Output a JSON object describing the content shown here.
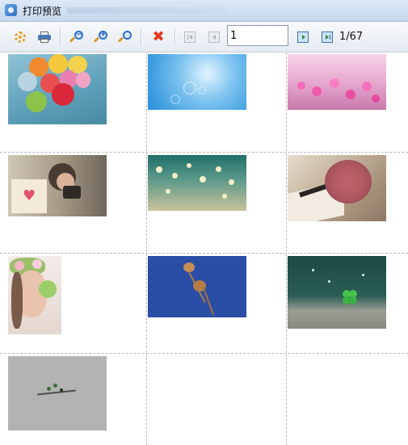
{
  "window": {
    "title": "打印预览"
  },
  "toolbar": {
    "buttons": [
      {
        "name": "settings",
        "icon": "gear-icon"
      },
      {
        "name": "print",
        "icon": "printer-icon"
      },
      {
        "name": "zoom-out",
        "icon": "zoom-out-icon"
      },
      {
        "name": "zoom-in",
        "icon": "zoom-in-icon"
      },
      {
        "name": "zoom",
        "icon": "zoom-icon"
      },
      {
        "name": "close",
        "icon": "close-icon"
      },
      {
        "name": "first-page",
        "icon": "first-page-icon"
      },
      {
        "name": "previous-page",
        "icon": "previous-page-icon"
      },
      {
        "name": "next-page",
        "icon": "next-page-icon"
      },
      {
        "name": "last-page",
        "icon": "last-page-icon"
      }
    ],
    "page_input_value": "1",
    "page_count": "1/67"
  },
  "grid": {
    "columns": 3,
    "images": [
      {
        "subject": "balloons"
      },
      {
        "subject": "blue sky bokeh"
      },
      {
        "subject": "pink flowers"
      },
      {
        "subject": "girl with camera and heart card"
      },
      {
        "subject": "bokeh lights"
      },
      {
        "subject": "rose on book"
      },
      {
        "subject": "girl with flower crown"
      },
      {
        "subject": "dried flower on blue"
      },
      {
        "subject": "four-leaf clover"
      },
      {
        "subject": "grey with small plant"
      }
    ]
  }
}
